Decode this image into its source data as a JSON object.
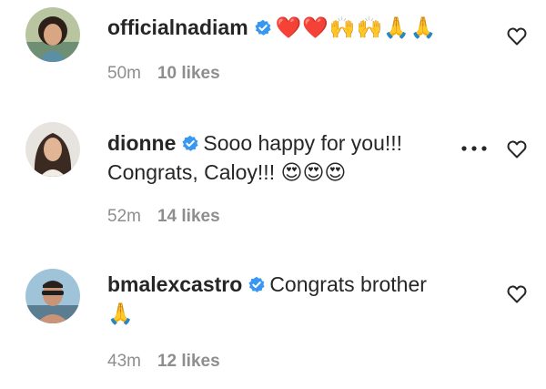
{
  "comments": [
    {
      "username": "officialnadiam",
      "text": "❤️❤️🙌🙌🙏🙏",
      "time": "50m",
      "likes": "10 likes"
    },
    {
      "username": "dionne",
      "text": "Sooo happy for you!!! Congrats, Caloy!!! 😍😍😍",
      "time": "52m",
      "likes": "14 likes"
    },
    {
      "username": "bmalexcastro",
      "text": "Congrats brother 🙏",
      "time": "43m",
      "likes": "12 likes"
    }
  ],
  "colors": {
    "verified": "#3897f0",
    "meta": "#8e8e8e",
    "text": "#262626"
  },
  "icons": {
    "verified": "verified-badge-icon",
    "like": "heart-outline-icon",
    "more": "more-options-icon"
  }
}
